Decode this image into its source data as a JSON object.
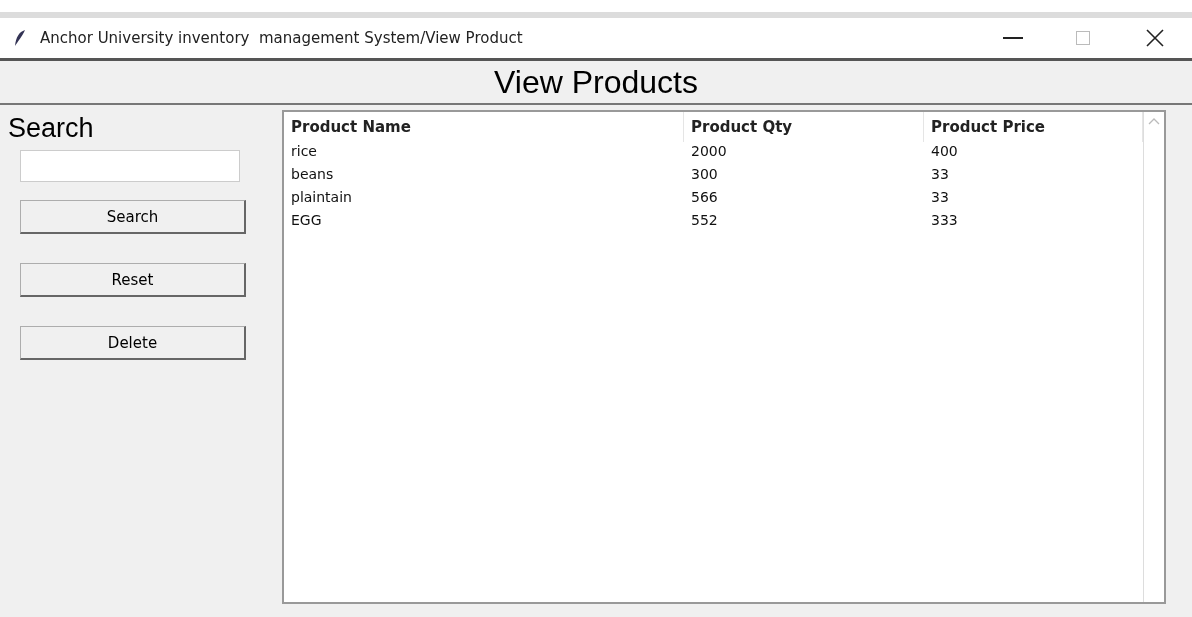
{
  "window": {
    "title": "Anchor University inventory  management System/View Product"
  },
  "heading": "View Products",
  "search": {
    "label": "Search"
  },
  "buttons": [
    "Search",
    "Reset",
    "Delete"
  ],
  "table": {
    "columns": [
      "Product Name",
      "Product Qty",
      "Product Price"
    ],
    "rows": [
      [
        "rice",
        "2000",
        "400"
      ],
      [
        "beans",
        "300",
        "33"
      ],
      [
        "plaintain",
        "566",
        "33"
      ],
      [
        "EGG",
        "552",
        "333"
      ]
    ]
  }
}
